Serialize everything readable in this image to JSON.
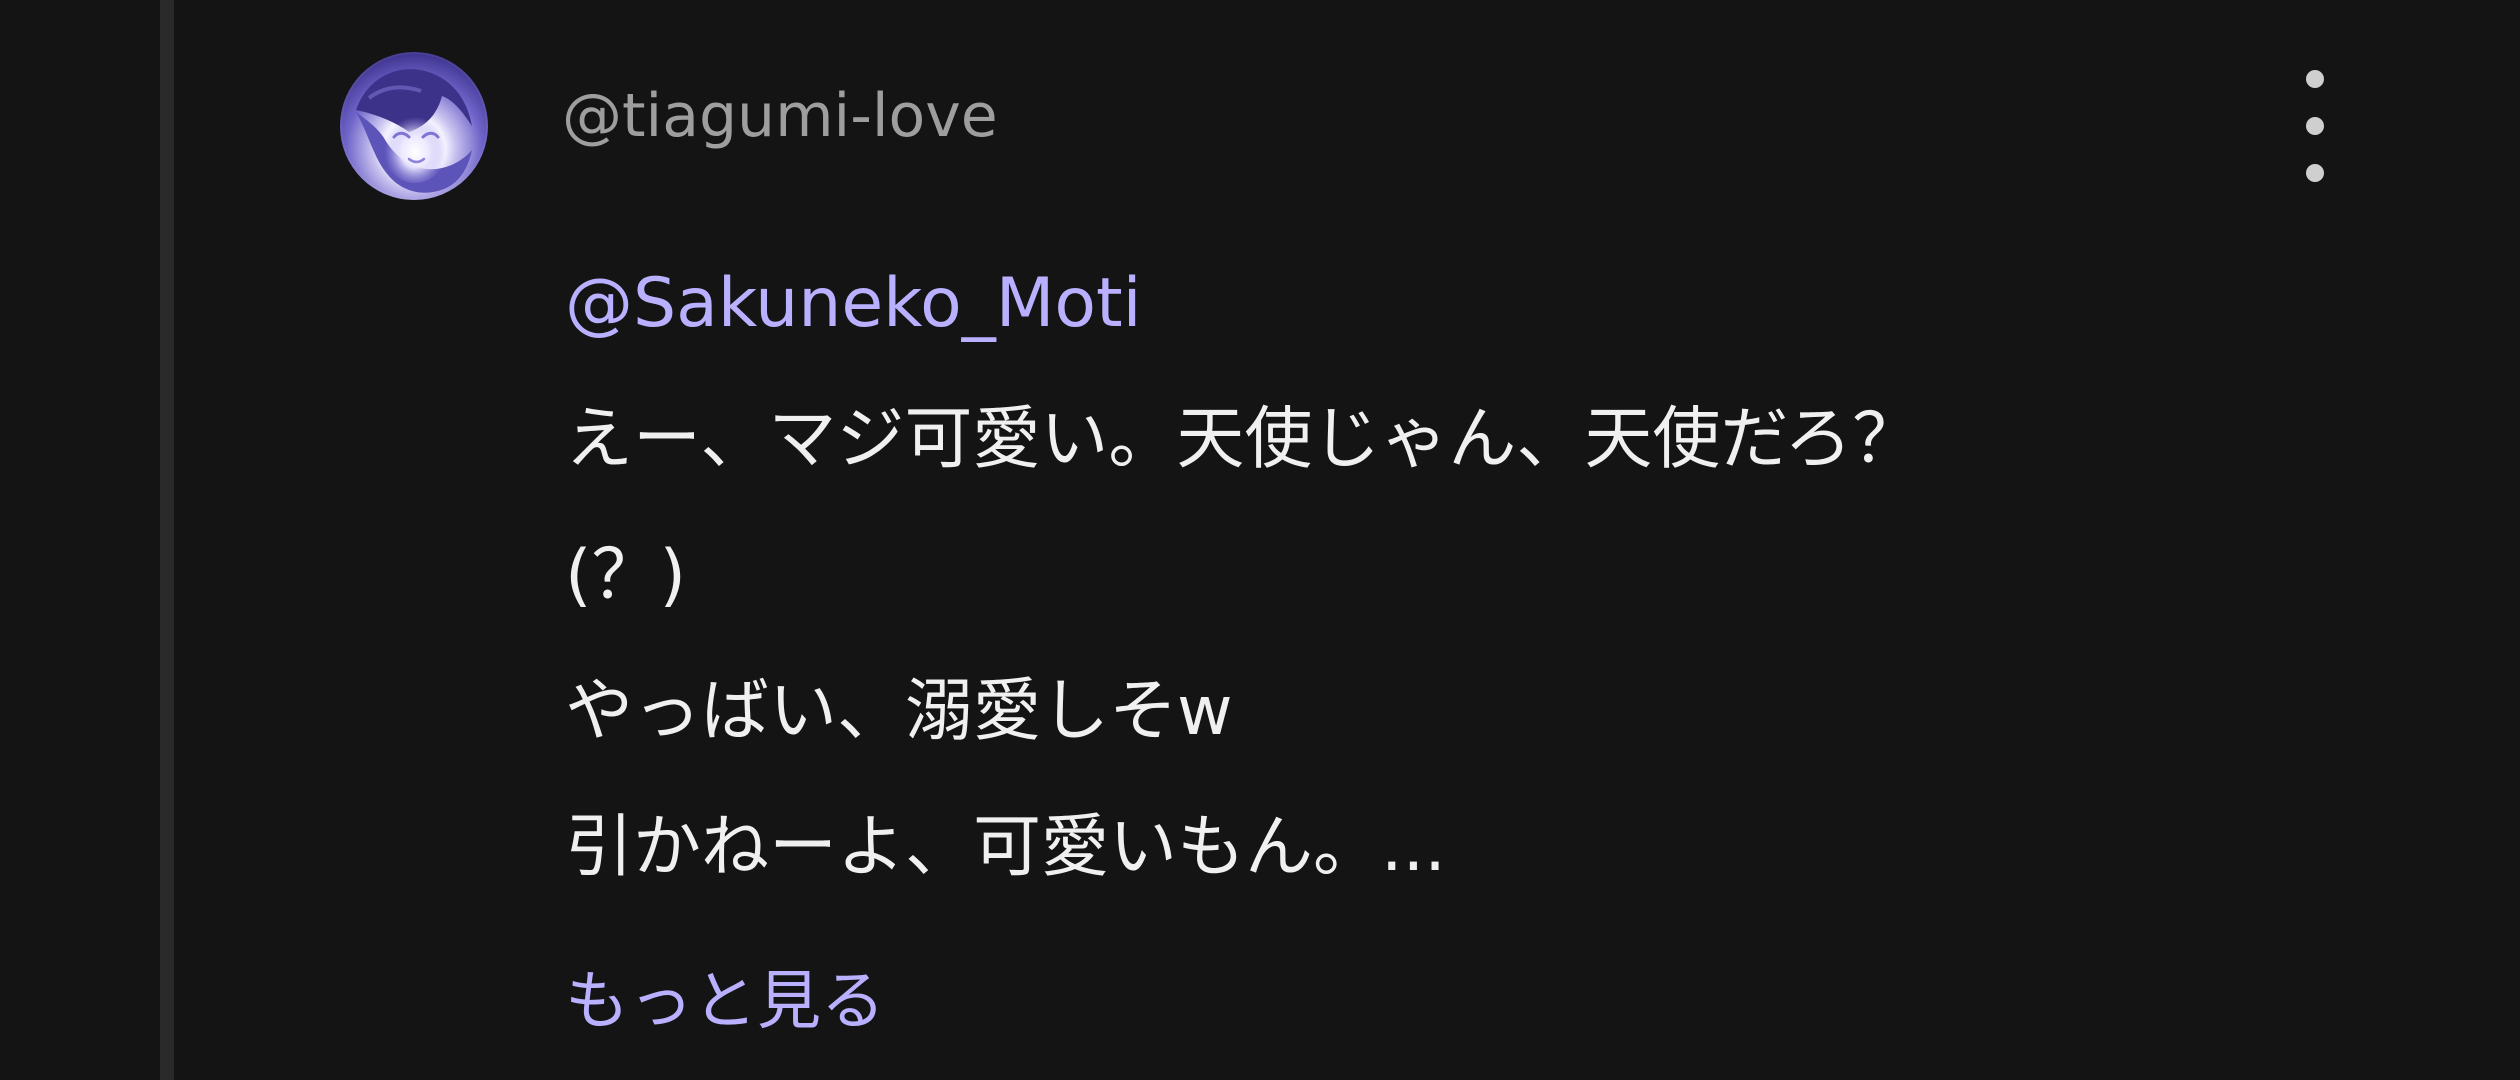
{
  "comment": {
    "username": "@tiagumi-love",
    "mention": "@Sakuneko_Moti",
    "lines": [
      "えー、マジ可愛い。天使じゃん、天使だろ？",
      "(？)",
      "やっばい、溺愛しそw",
      "引かねーよ、可愛いもん。..."
    ],
    "read_more": "もっと見る"
  },
  "icons": {
    "avatar": "avatar-image",
    "menu": "more-vertical-icon"
  },
  "colors": {
    "background": "#141414",
    "username": "#9e9e9e",
    "text": "#f0f0f0",
    "accent": "#b9b0ff"
  }
}
